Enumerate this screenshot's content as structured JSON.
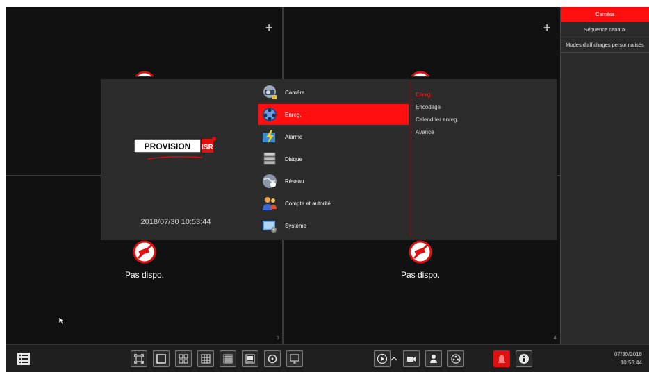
{
  "grid": {
    "cells": [
      {
        "number": "",
        "status": ""
      },
      {
        "number": "",
        "status": ""
      },
      {
        "number": "3",
        "status": "Pas dispo."
      },
      {
        "number": "4",
        "status": "Pas dispo."
      }
    ],
    "add_symbol": "+"
  },
  "right_panel": {
    "items": [
      {
        "label": "Caméra",
        "active": true
      },
      {
        "label": "Séquence canaux",
        "active": false
      },
      {
        "label": "Modes d'affichages personnalisés",
        "active": false
      }
    ]
  },
  "menu": {
    "datetime": "2018/07/30 10:53:44",
    "items": [
      {
        "label": "Caméra",
        "icon": "camera-icon"
      },
      {
        "label": "Enreg.",
        "icon": "film-reel-icon"
      },
      {
        "label": "Alarme",
        "icon": "alarm-icon"
      },
      {
        "label": "Disque",
        "icon": "disk-icon"
      },
      {
        "label": "Réseau",
        "icon": "network-globe-icon"
      },
      {
        "label": "Compte et autorité",
        "icon": "users-icon"
      },
      {
        "label": "Système",
        "icon": "system-icon"
      }
    ],
    "active_index": 1,
    "submenu": [
      {
        "label": "Enreg.",
        "active": true
      },
      {
        "label": "Encodage",
        "active": false
      },
      {
        "label": "Calendrier enreg.",
        "active": false
      },
      {
        "label": "Avancé",
        "active": false
      }
    ]
  },
  "taskbar": {
    "date": "07/30/2018",
    "time": "10:53:44"
  },
  "colors": {
    "accent_red": "#ff0f0f",
    "panel": "#2c2c2c",
    "background": "#111111"
  }
}
